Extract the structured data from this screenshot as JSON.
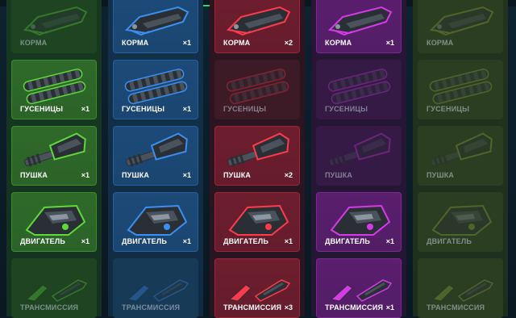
{
  "columns": [
    {
      "tier": "green",
      "colors": {
        "accent": "#5dd93a",
        "card_owned": "#2f6a2a",
        "card_missing": "#1f4422",
        "bg": "#163820"
      },
      "parts": [
        {
          "name": "КОРМА",
          "count": "",
          "owned": false
        },
        {
          "name": "ГУСЕНИЦЫ",
          "count": "×1",
          "owned": true
        },
        {
          "name": "ПУШКА",
          "count": "×1",
          "owned": true
        },
        {
          "name": "ДВИГАТЕЛЬ",
          "count": "×1",
          "owned": true
        },
        {
          "name": "ТРАНСМИССИЯ",
          "count": "",
          "owned": false
        }
      ]
    },
    {
      "tier": "blue",
      "colors": {
        "accent": "#3a8ff0",
        "card_owned": "#1d4a78",
        "card_missing": "#173a56",
        "bg": "#12304a"
      },
      "parts": [
        {
          "name": "КОРМА",
          "count": "×1",
          "owned": true
        },
        {
          "name": "ГУСЕНИЦЫ",
          "count": "×1",
          "owned": true
        },
        {
          "name": "ПУШКА",
          "count": "×1",
          "owned": true
        },
        {
          "name": "ДВИГАТЕЛЬ",
          "count": "×1",
          "owned": true
        },
        {
          "name": "ТРАНСМИССИЯ",
          "count": "",
          "owned": false
        }
      ]
    },
    {
      "tier": "red",
      "colors": {
        "accent": "#ff3a4a",
        "card_owned": "#6e1e2e",
        "card_missing": "#3c1a26",
        "bg": "#2e1420"
      },
      "parts": [
        {
          "name": "КОРМА",
          "count": "×2",
          "owned": true
        },
        {
          "name": "ГУСЕНИЦЫ",
          "count": "",
          "owned": false
        },
        {
          "name": "ПУШКА",
          "count": "×2",
          "owned": true
        },
        {
          "name": "ДВИГАТЕЛЬ",
          "count": "×1",
          "owned": true
        },
        {
          "name": "ТРАНСМИССИЯ",
          "count": "×3",
          "owned": true
        }
      ]
    },
    {
      "tier": "purple",
      "colors": {
        "accent": "#d63ae8",
        "card_owned": "#5a1f6e",
        "card_missing": "#341a44",
        "bg": "#281636"
      },
      "parts": [
        {
          "name": "КОРМА",
          "count": "×1",
          "owned": true
        },
        {
          "name": "ГУСЕНИЦЫ",
          "count": "",
          "owned": false
        },
        {
          "name": "ПУШКА",
          "count": "",
          "owned": false
        },
        {
          "name": "ДВИГАТЕЛЬ",
          "count": "×1",
          "owned": true
        },
        {
          "name": "ТРАНСМИССИЯ",
          "count": "×1",
          "owned": true
        }
      ]
    },
    {
      "tier": "olive",
      "colors": {
        "accent": "#8fae3a",
        "card_owned": "#3c5026",
        "card_missing": "#2c3e22",
        "bg": "#22341c"
      },
      "parts": [
        {
          "name": "КОРМА",
          "count": "",
          "owned": false
        },
        {
          "name": "ГУСЕНИЦЫ",
          "count": "",
          "owned": false
        },
        {
          "name": "ПУШКА",
          "count": "",
          "owned": false
        },
        {
          "name": "ДВИГАТЕЛЬ",
          "count": "",
          "owned": false
        },
        {
          "name": "ТРАНСМИССИЯ",
          "count": "",
          "owned": false
        }
      ]
    }
  ],
  "icons": {
    "КОРМА": "tank-hull-rear-icon",
    "ГУСЕНИЦЫ": "tank-tracks-icon",
    "ПУШКА": "tank-gun-icon",
    "ДВИГАТЕЛЬ": "tank-engine-icon",
    "ТРАНСМИССИЯ": "tank-transmission-icon"
  }
}
